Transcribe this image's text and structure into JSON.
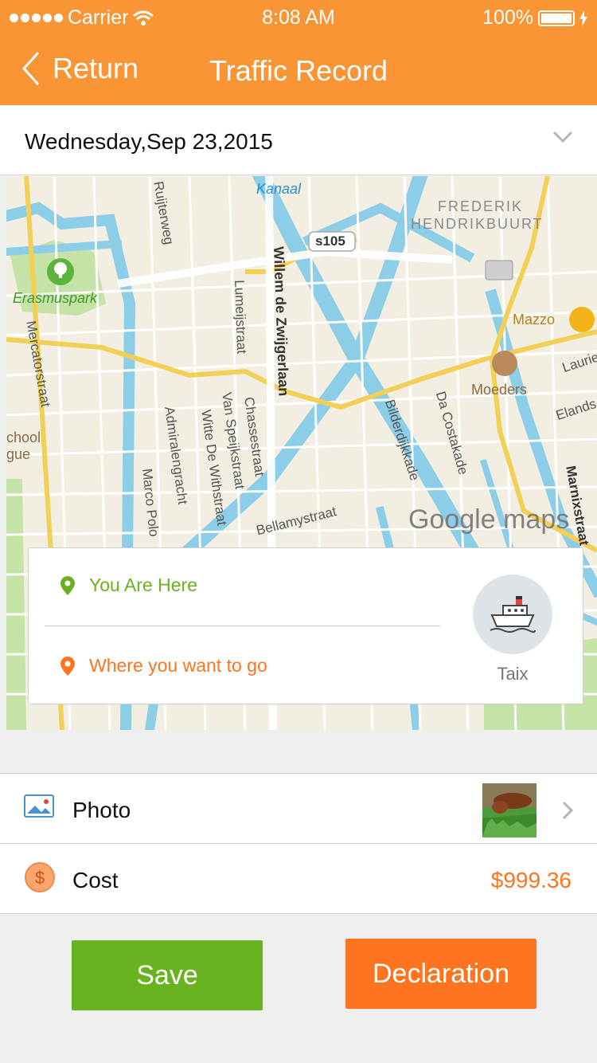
{
  "status": {
    "carrier": "Carrier",
    "time": "8:08 AM",
    "battery": "100%"
  },
  "nav": {
    "back_label": "Return",
    "title": "Traffic Record"
  },
  "date_selector": {
    "value": "Wednesday,Sep 23,2015"
  },
  "map": {
    "watermark": "Google maps",
    "labels": {
      "kanaal": "Kanaal",
      "frederik": "FREDERIK",
      "hendrikbuurt": "HENDRIKBUURT",
      "s105": "s105",
      "erasmuspark": "Erasmuspark",
      "ruijterweg": "Ruijterweg",
      "willem": "Willem de Zwijgerlaan",
      "lumeijstraat": "Lumeijstraat",
      "mercatorstraat": "Mercatorstraat",
      "mazzo": "Mazzo",
      "moeders": "Moeders",
      "admiralengracht": "Admiralengracht",
      "witte": "Witte De Withstraat",
      "vanspeijk": "Van Speijkstraat",
      "chasse": "Chassestraat",
      "bilderdijkkade": "Bilderdijkkade",
      "dacostakade": "Da Costakade",
      "marnixstraat": "Marnixstraat",
      "bellamystraat": "Bellamystraat",
      "marcopolo": "Marco Polo",
      "school": "chool",
      "gue": "gue",
      "laurier": "Laurie",
      "elands": "Elands"
    }
  },
  "route": {
    "from_label": "You Are Here",
    "to_label": "Where you want to go",
    "transport_label": "Taix"
  },
  "rows": {
    "photo_label": "Photo",
    "cost_label": "Cost",
    "cost_value": "$999.36"
  },
  "buttons": {
    "save_label": "Save",
    "declaration_label": "Declaration"
  },
  "colors": {
    "header": "#fa9535",
    "accent_orange": "#ff7420",
    "accent_green": "#68b31f"
  }
}
